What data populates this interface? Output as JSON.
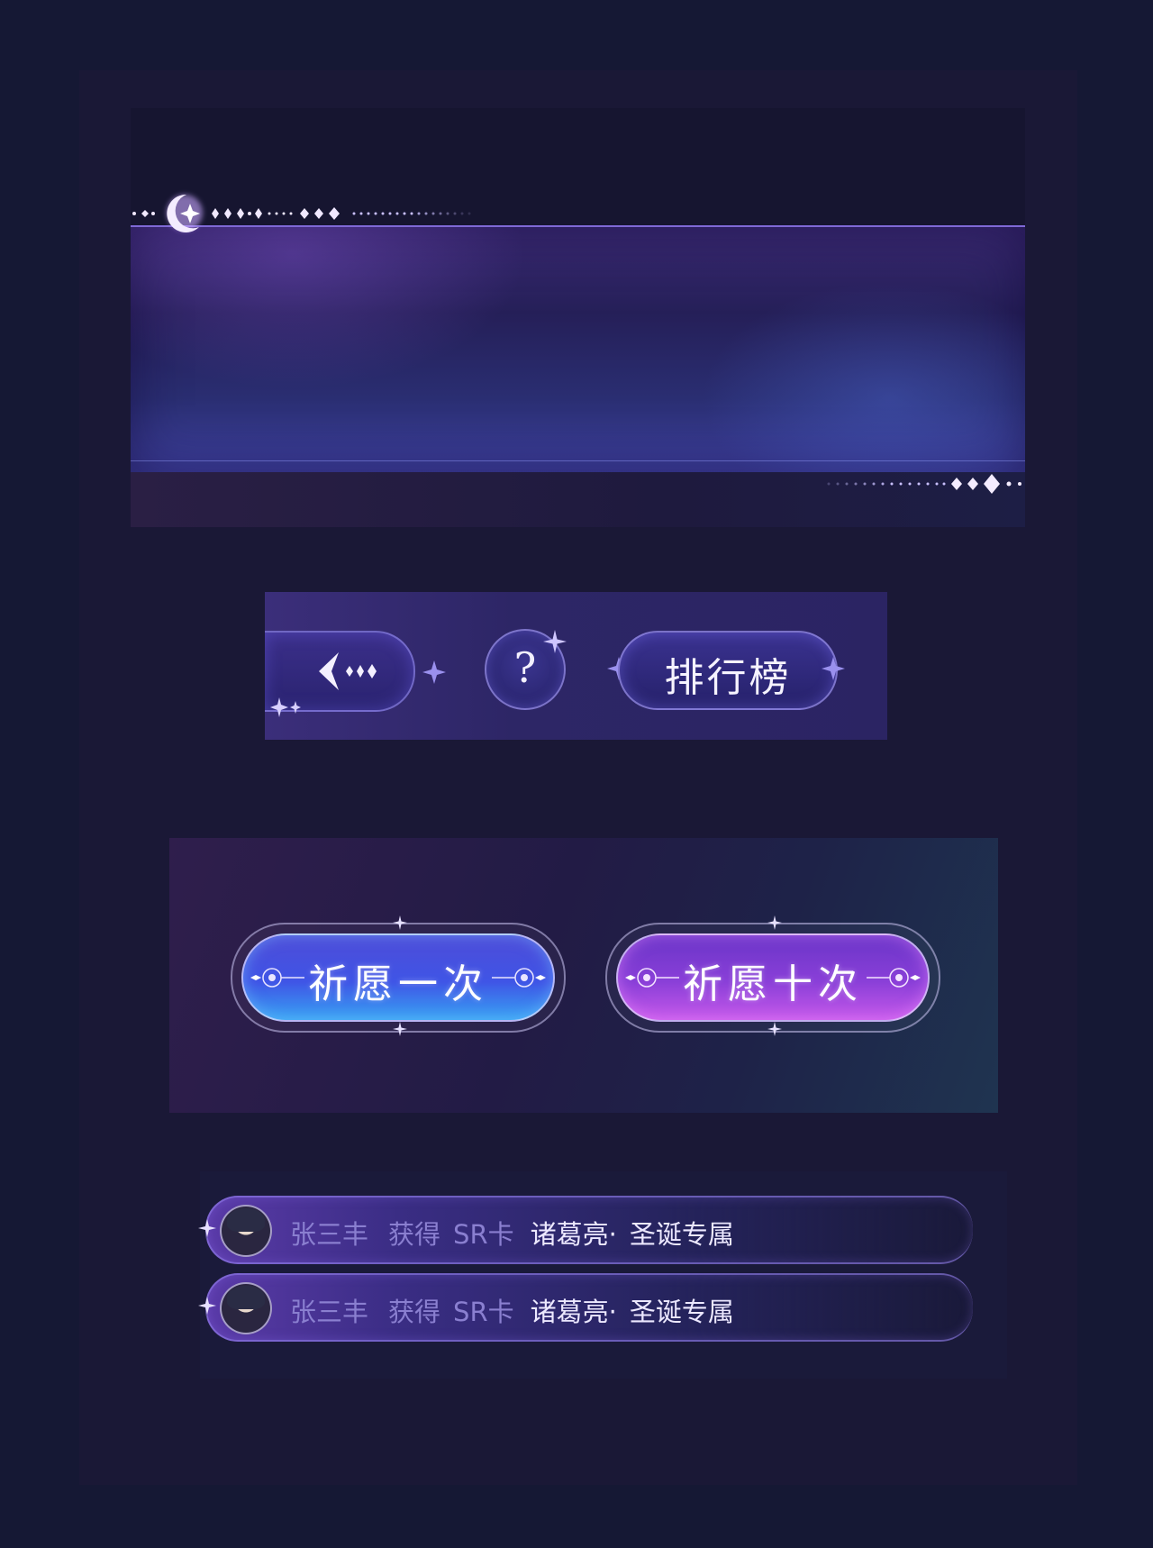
{
  "colors": {
    "background": "#151834",
    "panel": "#1a1836",
    "accent_purple": "#8a3fd8",
    "accent_blue": "#3f55e6",
    "muted_text": "#8a7fd0",
    "bright_text": "#ece8ff"
  },
  "nav": {
    "back_icon": "back-arrow-icon",
    "help_label": "?",
    "rank_label": "排行榜"
  },
  "wish": {
    "once_label": "祈愿一次",
    "ten_label": "祈愿十次"
  },
  "notifications": [
    {
      "user": "张三丰",
      "verb": "获得",
      "rarity": "SR卡",
      "card": "诸葛亮·",
      "variant": "圣诞专属"
    },
    {
      "user": "张三丰",
      "verb": "获得",
      "rarity": "SR卡",
      "card": "诸葛亮·",
      "variant": "圣诞专属"
    }
  ]
}
